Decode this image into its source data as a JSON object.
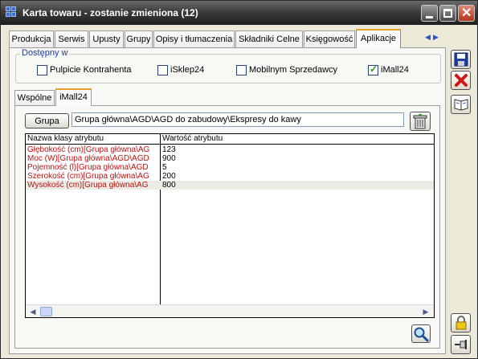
{
  "window": {
    "title": "Karta towaru - zostanie zmieniona (12)"
  },
  "tabs": [
    {
      "label": "Produkcja"
    },
    {
      "label": "Serwis"
    },
    {
      "label": "Upusty"
    },
    {
      "label": "Grupy"
    },
    {
      "label": "Opisy i tłumaczenia"
    },
    {
      "label": "Składniki Celne"
    },
    {
      "label": "Księgowość"
    },
    {
      "label": "Aplikacje"
    }
  ],
  "active_tab": "Aplikacje",
  "availability": {
    "legend": "Dostępny w",
    "options": [
      {
        "label": "Pulpicie Kontrahenta",
        "checked": false
      },
      {
        "label": "iSklep24",
        "checked": false
      },
      {
        "label": "Mobilnym Sprzedawcy",
        "checked": false
      },
      {
        "label": "iMall24",
        "checked": true
      }
    ]
  },
  "subtabs": [
    {
      "label": "Wspólne"
    },
    {
      "label": "iMall24"
    }
  ],
  "active_subtab": "iMall24",
  "group": {
    "button_label": "Grupa",
    "value": "Grupa główna\\AGD\\AGD do zabudowy\\Ekspresy do kawy"
  },
  "attributes": {
    "columns": [
      "Nazwa klasy atrybutu",
      "Wartość atrybutu"
    ],
    "rows": [
      {
        "name": "Głębokość (cm)[Grupa główna\\AG",
        "value": "123"
      },
      {
        "name": "Moc (W)[Grupa główna\\AGD\\AGD",
        "value": "900"
      },
      {
        "name": "Pojemność (l)[Grupa główna\\AGD",
        "value": "5"
      },
      {
        "name": "Szerokość (cm)[Grupa główna\\AG",
        "value": "200"
      },
      {
        "name": "Wysokość (cm)[Grupa główna\\AG",
        "value": "800"
      }
    ],
    "selected_row": 4
  },
  "colors": {
    "accent_tab": "#e6a12e",
    "attribute_name": "#c21010",
    "legend_text": "#1d3c9e",
    "check_tick": "#21a121"
  },
  "icons": {
    "title": "app-grid-icon",
    "save": "floppy-disk-icon",
    "delete": "red-x-icon",
    "help": "open-book-icon",
    "clear": "trash-can-icon",
    "search": "magnifier-icon",
    "lock": "padlock-icon",
    "pin": "pin-icon"
  }
}
